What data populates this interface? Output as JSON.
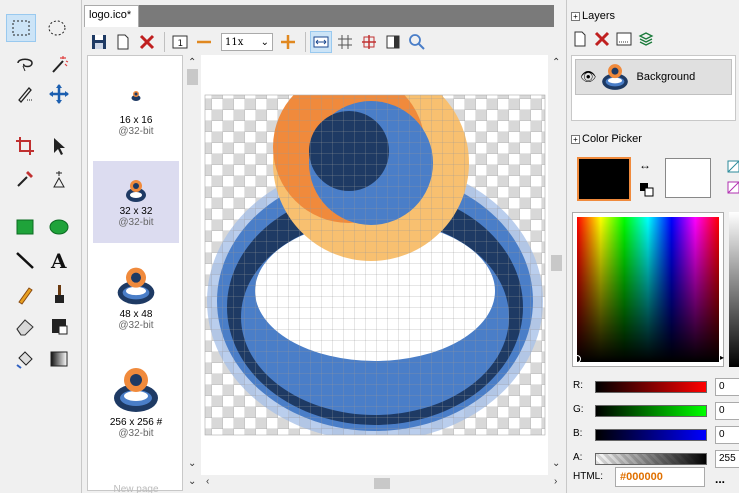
{
  "document": {
    "tab_title": "logo.ico*"
  },
  "toolbar": {
    "zoom_value": "11x"
  },
  "formats": [
    {
      "size": "16 x 16",
      "depth": "@32-bit"
    },
    {
      "size": "32 x 32",
      "depth": "@32-bit"
    },
    {
      "size": "48 x 48",
      "depth": "@32-bit"
    },
    {
      "size": "256 x 256 #",
      "depth": "@32-bit"
    },
    {
      "size": "New page"
    }
  ],
  "layers": {
    "title": "Layers",
    "items": [
      {
        "name": "Background"
      }
    ]
  },
  "color_picker": {
    "title": "Color Picker",
    "primary_color": "#000000",
    "secondary_color": "#ffffff",
    "r_label": "R:",
    "r_value": "0",
    "g_label": "G:",
    "g_value": "0",
    "b_label": "B:",
    "b_value": "0",
    "a_label": "A:",
    "a_value": "255",
    "html_label": "HTML:",
    "html_value": "#000000"
  },
  "colors": {
    "accent": "#f0883c",
    "dark_blue": "#1e3a64",
    "mid_blue": "#4a7ec8",
    "light_orange": "#f8c070"
  }
}
